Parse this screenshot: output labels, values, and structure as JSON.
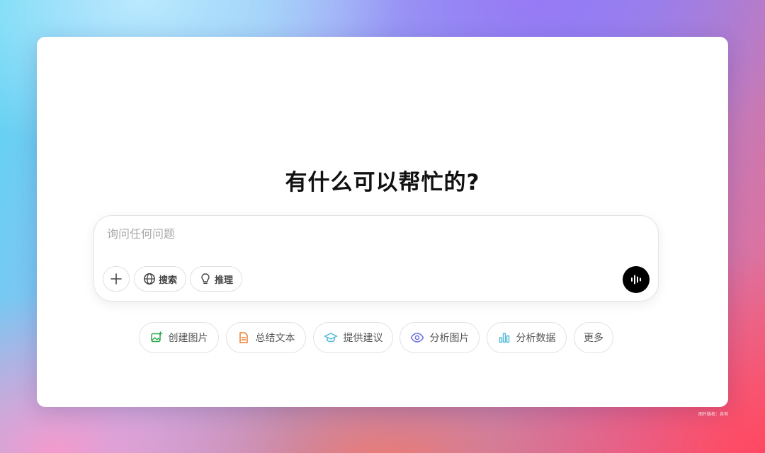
{
  "main": {
    "title": "有什么可以帮忙的?"
  },
  "composer": {
    "placeholder": "询问任何问题",
    "value": "",
    "tools": {
      "search_label": "搜索",
      "reason_label": "推理"
    }
  },
  "suggestions": [
    {
      "label": "创建图片",
      "icon": "image-plus-icon",
      "color": "#2ea84e"
    },
    {
      "label": "总结文本",
      "icon": "document-icon",
      "color": "#ef7d2b"
    },
    {
      "label": "提供建议",
      "icon": "graduation-cap-icon",
      "color": "#4fb8d8"
    },
    {
      "label": "分析图片",
      "icon": "eye-icon",
      "color": "#6a6ee0"
    },
    {
      "label": "分析数据",
      "icon": "bar-chart-icon",
      "color": "#4fb8d8"
    },
    {
      "label": "更多",
      "icon": "",
      "color": ""
    }
  ],
  "footer": {
    "credit": "图片版权：自何"
  }
}
